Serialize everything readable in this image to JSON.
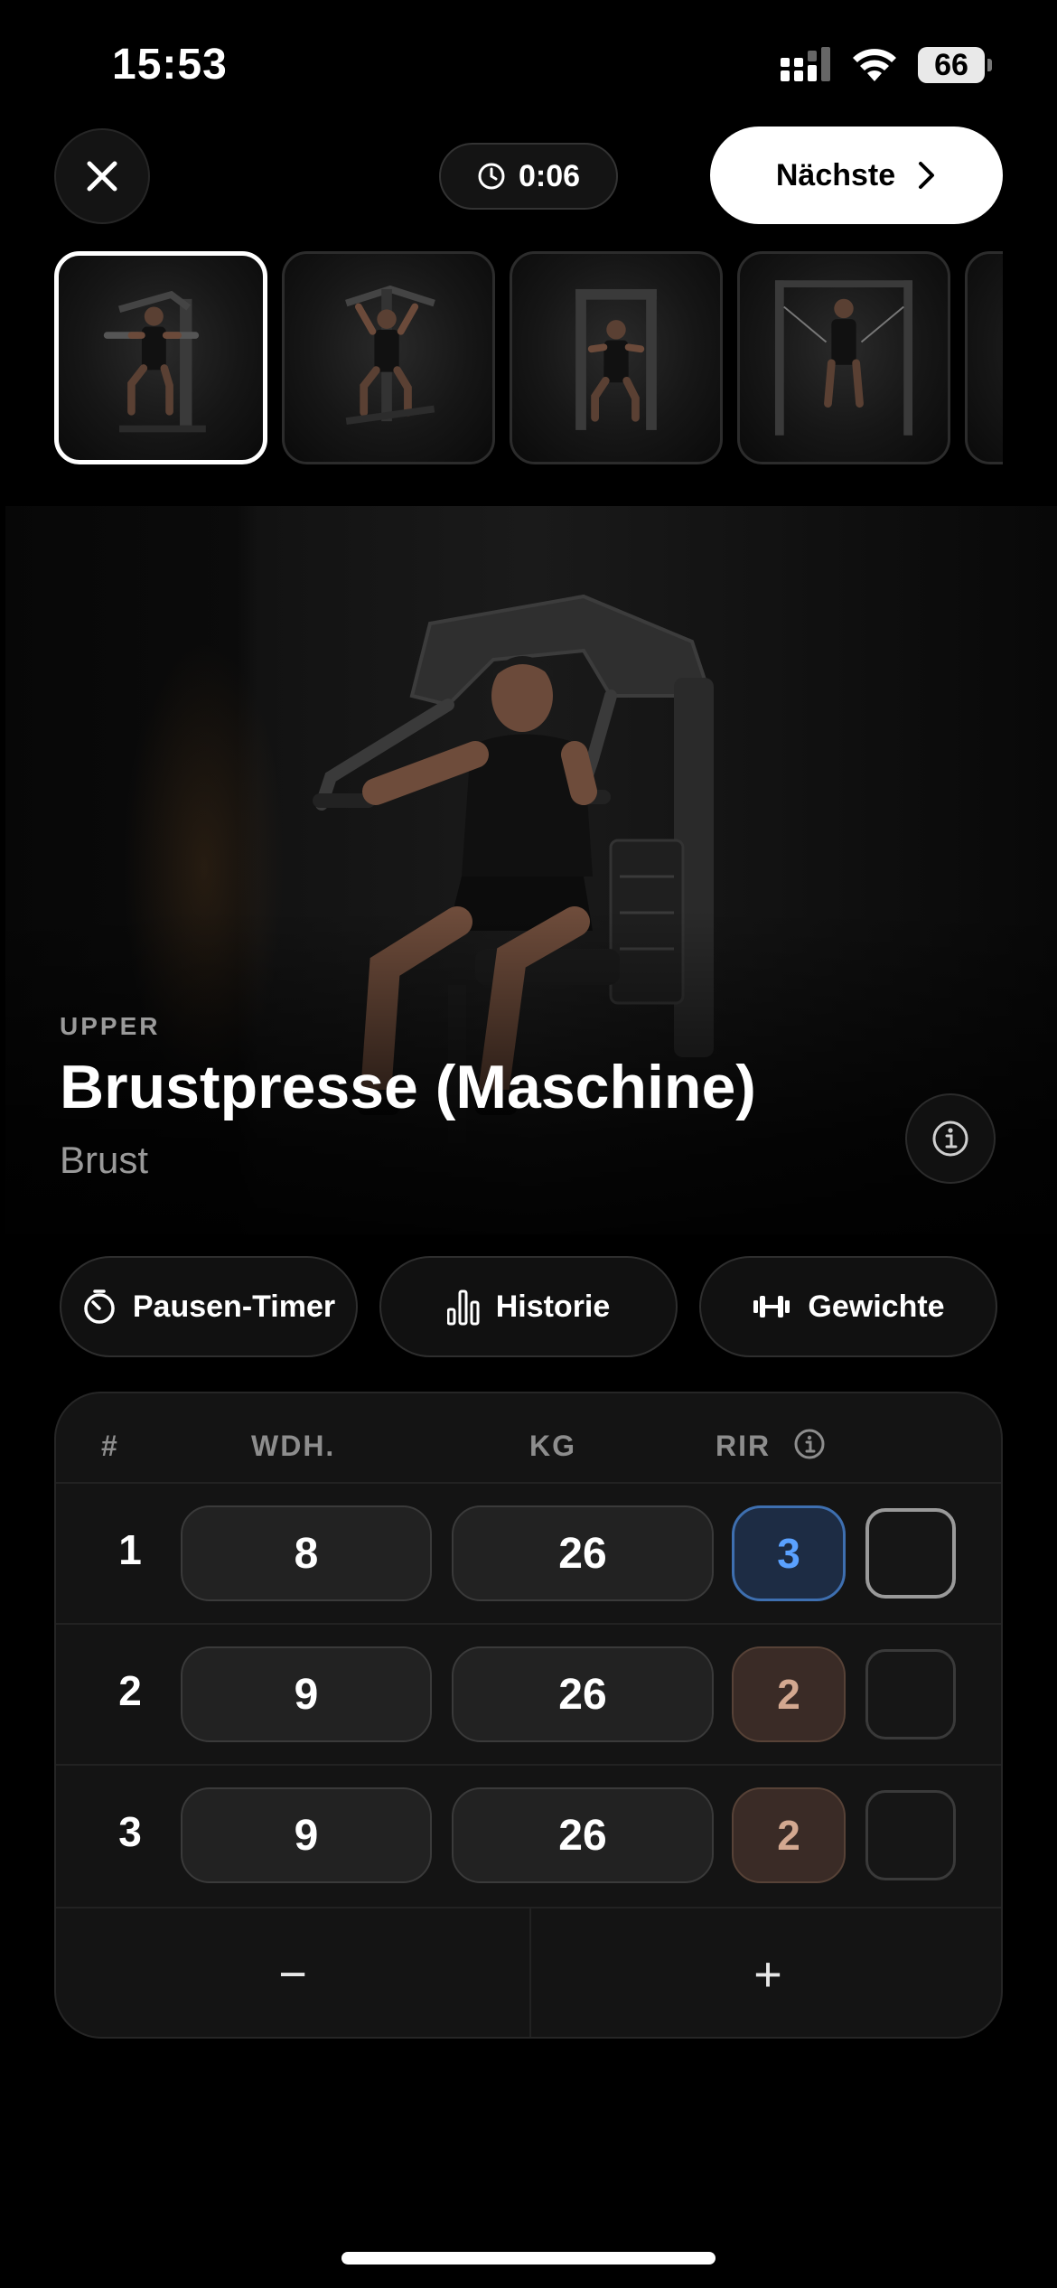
{
  "status_bar": {
    "time": "15:53",
    "battery": "66"
  },
  "top_bar": {
    "timer": "0:06",
    "next_label": "Nächste"
  },
  "thumbnails": [
    "brustpresse",
    "schraegbank",
    "butterfly",
    "kabelzug"
  ],
  "exercise": {
    "category": "UPPER",
    "title": "Brustpresse (Maschine)",
    "muscle": "Brust"
  },
  "actions": {
    "rest_timer": "Pausen-Timer",
    "history": "Historie",
    "weights": "Gewichte"
  },
  "table": {
    "headers": {
      "num": "#",
      "reps": "WDH.",
      "kg": "KG",
      "rir": "RIR"
    },
    "sets": [
      {
        "num": "1",
        "reps": "8",
        "kg": "26",
        "rir": "3",
        "rir_color": "#5aa1ff"
      },
      {
        "num": "2",
        "reps": "9",
        "kg": "26",
        "rir": "2",
        "rir_color": "#d3a890"
      },
      {
        "num": "3",
        "reps": "9",
        "kg": "26",
        "rir": "2",
        "rir_color": "#d3a890"
      }
    ],
    "remove_set": "−",
    "add_set": "+"
  },
  "colors": {
    "background": "#000000",
    "card": "#141414",
    "accent_blue": "#5aa1ff"
  }
}
